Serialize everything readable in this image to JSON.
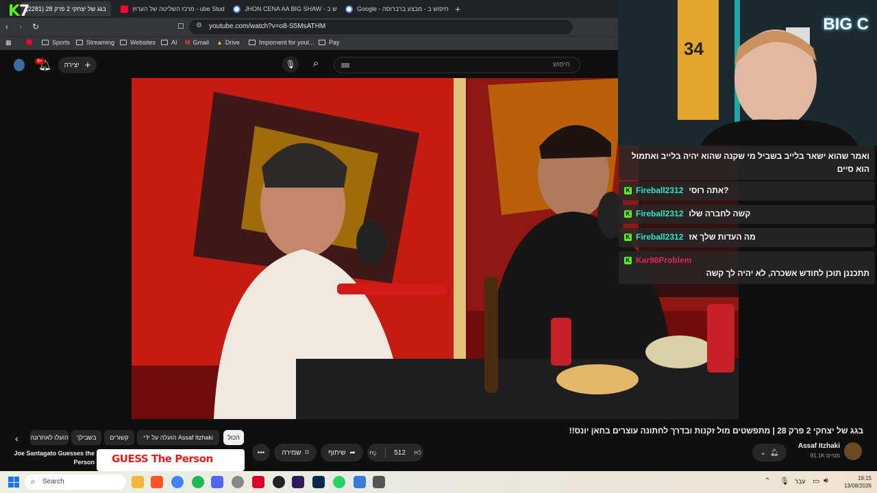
{
  "browser": {
    "tabs": [
      {
        "title": "(2281) בגג של יצחקי 2 פרק 28",
        "color": "#ff0000"
      },
      {
        "title": "מרכז השליטה של הערוץ - ube Studio",
        "color": "#ff0033"
      },
      {
        "title": "JHON CENA AA BIG SHAW - חיפוש ב",
        "color": "#4285f4"
      },
      {
        "title": "Google - חיפוש ב - מבצע ברברוסה",
        "color": "#4285f4"
      }
    ],
    "new_tab": "+",
    "url": "youtube.com/watch?v=o8-S5MsATHM",
    "bookmarks": [
      "Sports",
      "Streaming",
      "Websites",
      "AI",
      "Gmail",
      "Drive",
      "Impornent for yout...",
      "Pay"
    ]
  },
  "kick_logo": {
    "letter": "K",
    "number": "7"
  },
  "youtube": {
    "search_placeholder": "חיפוש",
    "create_label": "יצירה",
    "notif_count": "9+",
    "video_title": "בגג של יצחקי 2 פרק 28 | מתפשטים מול זקנות ובדרך לחתונה עוצרים בחאן יונס!!",
    "channel_name": "Assaf Itzhaki",
    "subscribers": "91.1K מנויים",
    "likes": "512",
    "share_label": "שיתוף",
    "save_label": "שמירה",
    "more_label": "•••",
    "chips": [
      "הכול",
      "הועלה על ידי Assaf Itzhaki",
      "קשורים",
      "בשבילך",
      "הועלו לאחרונה"
    ],
    "side_video_title": "Joe Santagato Guesses the Person",
    "side_thumb_text": "GUESS The Person"
  },
  "webcam": {
    "logo": "BIG C",
    "jersey_number": "34"
  },
  "chat": [
    {
      "user": "",
      "text": "ואמר שהוא ישאר בלייב בשביל מי שקנה שהוא יהיה בלייב ואתמול הוא סיים",
      "user_color": "#ffffff"
    },
    {
      "user": "Fireball2312",
      "text": "אתה רוסי?",
      "user_color": "#2ee6c8"
    },
    {
      "user": "Fireball2312",
      "text": "קשה לחברה שלו",
      "user_color": "#2ee6c8"
    },
    {
      "user": "Fireball2312",
      "text": "מה העדות שלך אז",
      "user_color": "#2ee6c8"
    },
    {
      "user": "Kar98Problem",
      "text": "תתכננן תוכן לחודש אשכרה, לא יהיה לך קשה",
      "user_color": "#e0245e"
    }
  ],
  "taskbar": {
    "search_placeholder": "Search",
    "language": "עבר",
    "time": "19:15",
    "date": "13/08/2026"
  }
}
